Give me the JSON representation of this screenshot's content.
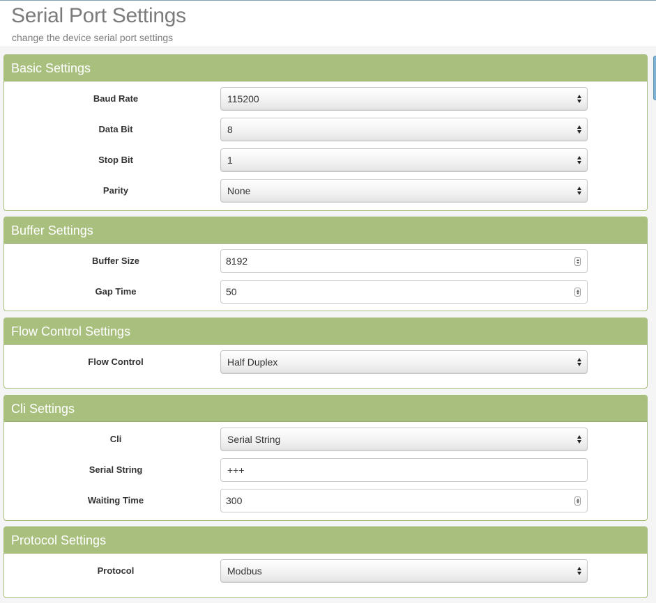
{
  "header": {
    "title": "Serial Port Settings",
    "subtitle": "change the device serial port settings"
  },
  "sections": {
    "basic": {
      "title": "Basic Settings",
      "baud_rate": {
        "label": "Baud Rate",
        "value": "115200"
      },
      "data_bit": {
        "label": "Data Bit",
        "value": "8"
      },
      "stop_bit": {
        "label": "Stop Bit",
        "value": "1"
      },
      "parity": {
        "label": "Parity",
        "value": "None"
      }
    },
    "buffer": {
      "title": "Buffer Settings",
      "buffer_size": {
        "label": "Buffer Size",
        "value": "8192"
      },
      "gap_time": {
        "label": "Gap Time",
        "value": "50"
      }
    },
    "flow": {
      "title": "Flow Control Settings",
      "flow_control": {
        "label": "Flow Control",
        "value": "Half Duplex"
      }
    },
    "cli": {
      "title": "Cli Settings",
      "cli": {
        "label": "Cli",
        "value": "Serial String"
      },
      "serial_string": {
        "label": "Serial String",
        "value": "+++"
      },
      "waiting_time": {
        "label": "Waiting Time",
        "value": "300"
      }
    },
    "protocol": {
      "title": "Protocol Settings",
      "protocol": {
        "label": "Protocol",
        "value": "Modbus"
      }
    }
  },
  "colors": {
    "panel_header": "#a8bf7e",
    "panel_border": "#a6bd7c",
    "title_text": "#7b7b7b"
  },
  "icons": {
    "select": "updown-arrows-icon",
    "number": "spinner-icon"
  }
}
